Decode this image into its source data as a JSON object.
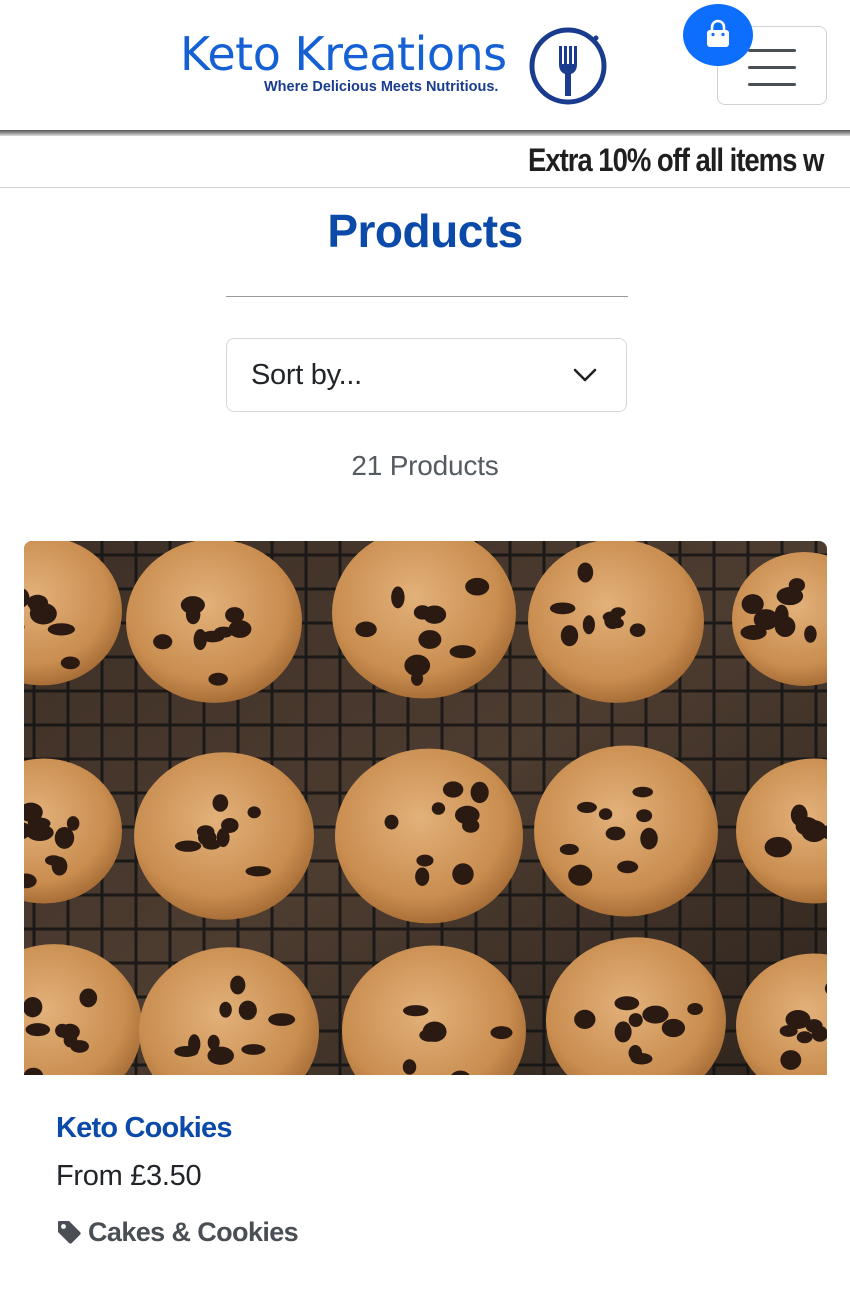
{
  "brand": {
    "name": "Keto Kreations",
    "tagline": "Where Delicious Meets Nutritious.",
    "color": "#1560d4"
  },
  "header": {
    "cart_icon": "shopping-bag-icon",
    "menu_icon": "hamburger-menu-icon"
  },
  "banner": {
    "text": "Extra 10% off all items w"
  },
  "page": {
    "title": "Products",
    "sort": {
      "selected": "Sort by..."
    },
    "product_count": "21 Products"
  },
  "products": [
    {
      "name": "Keto Cookies",
      "price": "From £3.50",
      "category": "Cakes & Cookies",
      "image": "chocolate-chip-cookies-on-cooling-rack"
    }
  ],
  "colors": {
    "primary_blue": "#0b4aa8",
    "cart_button": "#0d6efd"
  }
}
